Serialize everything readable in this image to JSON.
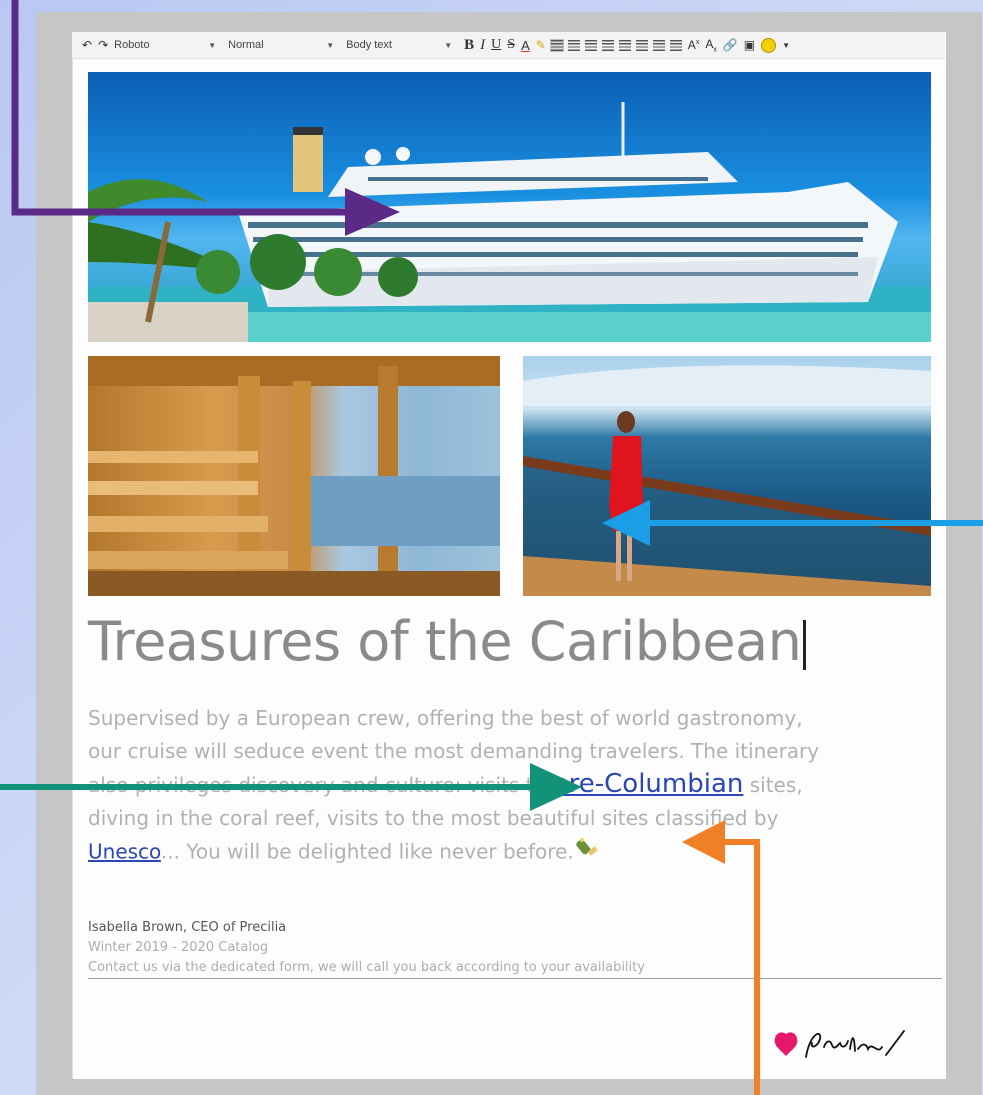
{
  "toolbar": {
    "font": "Roboto",
    "size": "Normal",
    "style": "Body text",
    "bold": "B",
    "italic": "I",
    "underline": "U",
    "strike": "S",
    "color": "A"
  },
  "title": "Treasures of the Caribbean",
  "paragraph": {
    "line1": "Supervised by a European crew, offering the best of world gastronomy,",
    "line2": "our cruise will seduce event the most demanding travelers. The itinerary",
    "line3_pre": "also privileges discovery and culture: visits to",
    "link1": "pre-Columbian",
    "line3_post": " sites,",
    "line4": "diving in the coral reef, visits to the most beautiful sites classified by",
    "link2": "Unesco",
    "line5_post": "... You will be delighted like never before."
  },
  "footer": {
    "author": "Isabella Brown, CEO of Precilia",
    "catalog": "Winter 2019 - 2020 Catalog",
    "contact": "Contact us via the dedicated form, we will call you back according to your availability"
  },
  "colors": {
    "arrow_purple": "#5b2a86",
    "arrow_blue": "#1a9ee6",
    "arrow_teal": "#13927a",
    "arrow_orange": "#f08026",
    "link": "#2a46b7"
  },
  "icons": [
    "undo-icon",
    "redo-icon",
    "highlight-icon",
    "align-left-icon",
    "align-center-icon",
    "align-right-icon",
    "justify-icon",
    "bullet-list-icon",
    "numbered-list-icon",
    "indent-icon",
    "outdent-icon",
    "superscript-icon",
    "subscript-icon",
    "link-icon",
    "image-icon",
    "emoji-icon",
    "champagne-icon"
  ]
}
